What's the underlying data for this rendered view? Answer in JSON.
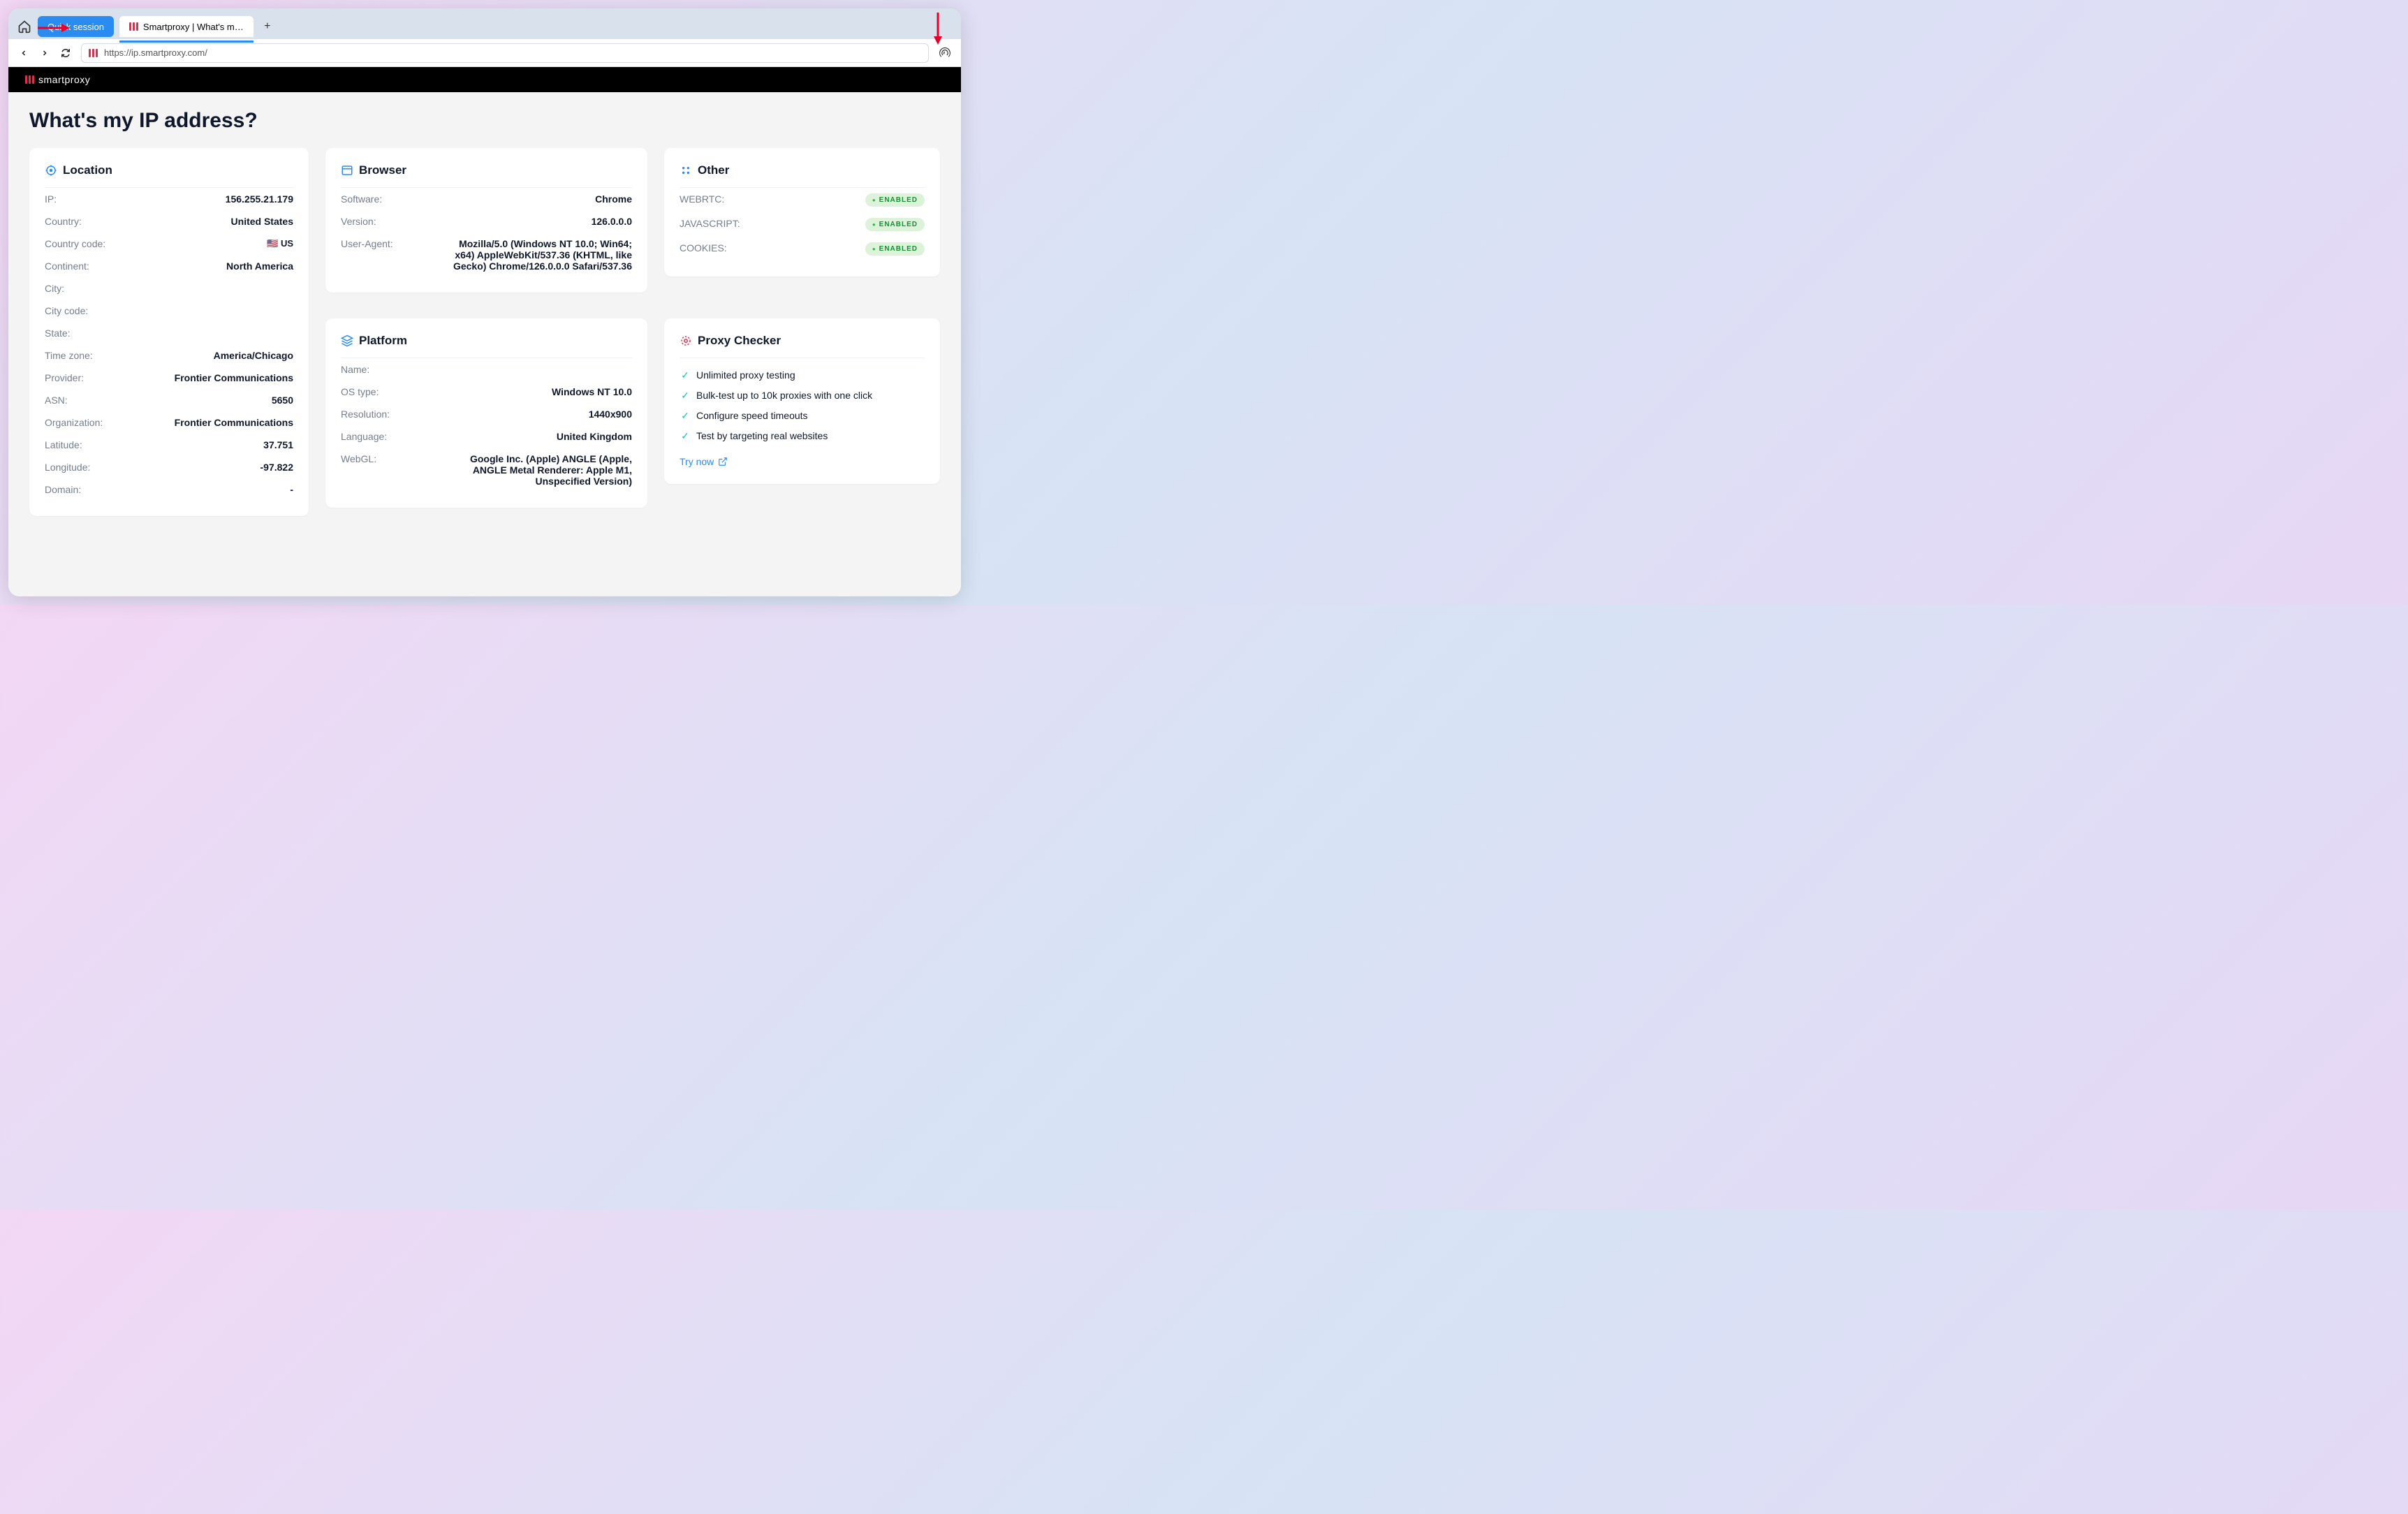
{
  "chrome": {
    "tabs": {
      "quick": "Quick session",
      "active": "Smartproxy | What's m…"
    },
    "url": "https://ip.smartproxy.com/"
  },
  "header": {
    "brand": "smartproxy"
  },
  "page": {
    "title": "What's my IP address?"
  },
  "location": {
    "title": "Location",
    "rows": {
      "ip_k": "IP:",
      "ip_v": "156.255.21.179",
      "country_k": "Country:",
      "country_v": "United States",
      "cc_k": "Country code:",
      "cc_v": "🇺🇸 US",
      "cont_k": "Continent:",
      "cont_v": "North America",
      "city_k": "City:",
      "city_v": "",
      "ccode_k": "City code:",
      "ccode_v": "",
      "state_k": "State:",
      "state_v": "",
      "tz_k": "Time zone:",
      "tz_v": "America/Chicago",
      "prov_k": "Provider:",
      "prov_v": "Frontier Communications",
      "asn_k": "ASN:",
      "asn_v": "5650",
      "org_k": "Organization:",
      "org_v": "Frontier Communications",
      "lat_k": "Latitude:",
      "lat_v": "37.751",
      "lon_k": "Longitude:",
      "lon_v": "-97.822",
      "dom_k": "Domain:",
      "dom_v": "-"
    }
  },
  "browser": {
    "title": "Browser",
    "rows": {
      "sw_k": "Software:",
      "sw_v": "Chrome",
      "ver_k": "Version:",
      "ver_v": "126.0.0.0",
      "ua_k": "User-Agent:",
      "ua_v": "Mozilla/5.0 (Windows NT 10.0; Win64; x64) AppleWebKit/537.36 (KHTML, like Gecko) Chrome/126.0.0.0 Safari/537.36"
    }
  },
  "platform": {
    "title": "Platform",
    "rows": {
      "name_k": "Name:",
      "name_v": "",
      "os_k": "OS type:",
      "os_v": "Windows NT 10.0",
      "res_k": "Resolution:",
      "res_v": "1440x900",
      "lang_k": "Language:",
      "lang_v": "United Kingdom",
      "webgl_k": "WebGL:",
      "webgl_v": "Google Inc. (Apple) ANGLE (Apple, ANGLE Metal Renderer: Apple M1, Unspecified Version)"
    }
  },
  "other": {
    "title": "Other",
    "rows": {
      "webrtc_k": "WEBRTC:",
      "webrtc_v": "ENABLED",
      "js_k": "JAVASCRIPT:",
      "js_v": "ENABLED",
      "ck_k": "COOKIES:",
      "ck_v": "ENABLED"
    }
  },
  "proxy": {
    "title": "Proxy Checker",
    "items": [
      "Unlimited proxy testing",
      "Bulk-test up to 10k proxies with one click",
      "Configure speed timeouts",
      "Test by targeting real websites"
    ],
    "cta": "Try now"
  }
}
